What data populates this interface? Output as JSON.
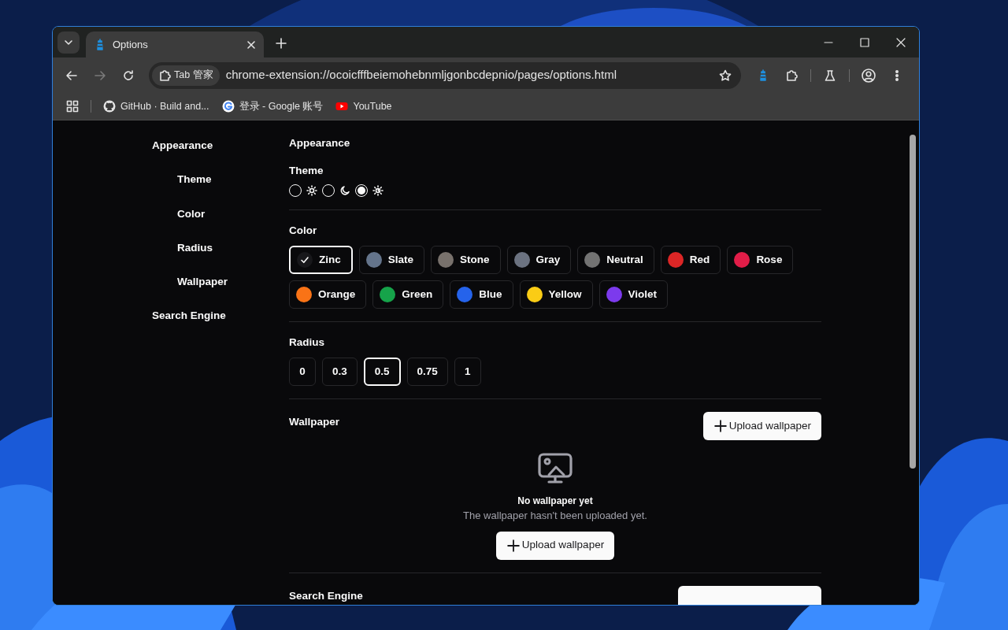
{
  "browser": {
    "tab": {
      "title": "Options"
    },
    "nav_buttons": [
      {
        "kind": "back",
        "disabled": false
      },
      {
        "kind": "forward",
        "disabled": true
      },
      {
        "kind": "reload",
        "disabled": false
      }
    ],
    "omnibox": {
      "chip": "Tab 管家",
      "url": "chrome-extension://ocoicfffbeiemohebnmljgonbcdepnio/pages/options.html"
    },
    "bookmarks": [
      {
        "kind": "github",
        "label": "GitHub · Build and..."
      },
      {
        "kind": "google",
        "label": "登录 - Google 账号"
      },
      {
        "kind": "youtube",
        "label": "YouTube"
      }
    ]
  },
  "sidebar": {
    "items": [
      {
        "label": "Appearance",
        "children": [
          {
            "label": "Theme"
          },
          {
            "label": "Color"
          },
          {
            "label": "Radius"
          },
          {
            "label": "Wallpaper"
          }
        ]
      },
      {
        "label": "Search Engine"
      }
    ]
  },
  "section_title": "Appearance",
  "theme": {
    "label": "Theme",
    "options": [
      {
        "kind": "light",
        "selected": false
      },
      {
        "kind": "dark",
        "selected": false
      },
      {
        "kind": "system",
        "selected": true
      }
    ]
  },
  "color": {
    "label": "Color",
    "options": [
      {
        "name": "Zinc",
        "color": "#18181b",
        "selected": true
      },
      {
        "name": "Slate",
        "color": "#64748b",
        "selected": false
      },
      {
        "name": "Stone",
        "color": "#78716c",
        "selected": false
      },
      {
        "name": "Gray",
        "color": "#6b7280",
        "selected": false
      },
      {
        "name": "Neutral",
        "color": "#737373",
        "selected": false
      },
      {
        "name": "Red",
        "color": "#dc2626",
        "selected": false
      },
      {
        "name": "Rose",
        "color": "#e11d48",
        "selected": false
      },
      {
        "name": "Orange",
        "color": "#f97316",
        "selected": false
      },
      {
        "name": "Green",
        "color": "#16a34a",
        "selected": false
      },
      {
        "name": "Blue",
        "color": "#2563eb",
        "selected": false
      },
      {
        "name": "Yellow",
        "color": "#facc15",
        "selected": false
      },
      {
        "name": "Violet",
        "color": "#7c3aed",
        "selected": false
      }
    ]
  },
  "radius": {
    "label": "Radius",
    "options": [
      {
        "value": "0",
        "selected": false
      },
      {
        "value": "0.3",
        "selected": false
      },
      {
        "value": "0.5",
        "selected": true
      },
      {
        "value": "0.75",
        "selected": false
      },
      {
        "value": "1",
        "selected": false
      }
    ]
  },
  "wallpaper": {
    "label": "Wallpaper",
    "upload_button": "Upload wallpaper",
    "empty_title": "No wallpaper yet",
    "empty_text": "The wallpaper hasn't been uploaded yet.",
    "empty_button": "Upload wallpaper"
  },
  "search_engine": {
    "label": "Search Engine"
  }
}
